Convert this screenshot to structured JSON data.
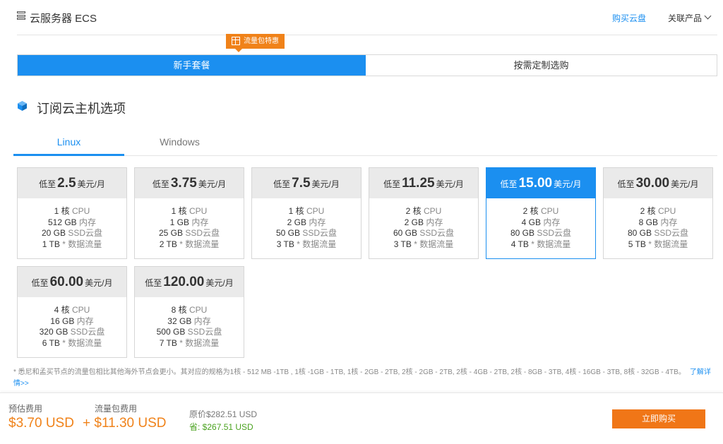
{
  "header": {
    "title": "云服务器 ECS",
    "buy_disk": "购买云盘",
    "related": "关联产品"
  },
  "promo": {
    "label": "流量包特惠"
  },
  "mode_tabs": [
    {
      "label": "新手套餐",
      "active": true
    },
    {
      "label": "按需定制选购",
      "active": false
    }
  ],
  "section": {
    "title": "订阅云主机选项"
  },
  "os_tabs": [
    {
      "label": "Linux",
      "active": true
    },
    {
      "label": "Windows",
      "active": false
    }
  ],
  "price_prefix": "低至",
  "price_suffix": "美元/月",
  "units": {
    "core": "核",
    "cpu": "CPU",
    "mem": "内存",
    "disk": "SSD云盘",
    "traffic": "* 数据流量"
  },
  "plans": [
    {
      "price": "2.5",
      "cores": "1",
      "mem": "512 GB",
      "disk": "20 GB",
      "traffic": "1 TB"
    },
    {
      "price": "3.75",
      "cores": "1",
      "mem": "1 GB",
      "disk": "25 GB",
      "traffic": "2 TB"
    },
    {
      "price": "7.5",
      "cores": "1",
      "mem": "2 GB",
      "disk": "50 GB",
      "traffic": "3 TB"
    },
    {
      "price": "11.25",
      "cores": "2",
      "mem": "2 GB",
      "disk": "60 GB",
      "traffic": "3 TB"
    },
    {
      "price": "15.00",
      "cores": "2",
      "mem": "4 GB",
      "disk": "80 GB",
      "traffic": "4 TB",
      "selected": true
    },
    {
      "price": "30.00",
      "cores": "2",
      "mem": "8 GB",
      "disk": "80 GB",
      "traffic": "5 TB"
    },
    {
      "price": "60.00",
      "cores": "4",
      "mem": "16 GB",
      "disk": "320 GB",
      "traffic": "6 TB"
    },
    {
      "price": "120.00",
      "cores": "8",
      "mem": "32 GB",
      "disk": "500 GB",
      "traffic": "7 TB"
    }
  ],
  "footnote": {
    "text": "* 悉尼和孟买节点的流量包相比其他海外节点会更小。其对应的规格为1核 - 512 MB -1TB , 1核 -1GB - 1TB, 1核 - 2GB - 2TB, 2核 - 2GB - 2TB, 2核 - 4GB - 2TB, 2核 - 8GB - 3TB, 4核 - 16GB - 3TB, 8核 - 32GB - 4TB。",
    "link": "了解详情>>"
  },
  "footer": {
    "est_label": "预估费用",
    "est_value": "$3.70 USD",
    "traffic_label": "流量包费用",
    "traffic_value": "+ $11.30 USD",
    "original": "原价$282.51 USD",
    "save": "省: $267.51 USD",
    "buy": "立即购买"
  },
  "colors": {
    "accent": "#1b8ff0",
    "orange": "#f08219",
    "green": "#4aa21f"
  }
}
